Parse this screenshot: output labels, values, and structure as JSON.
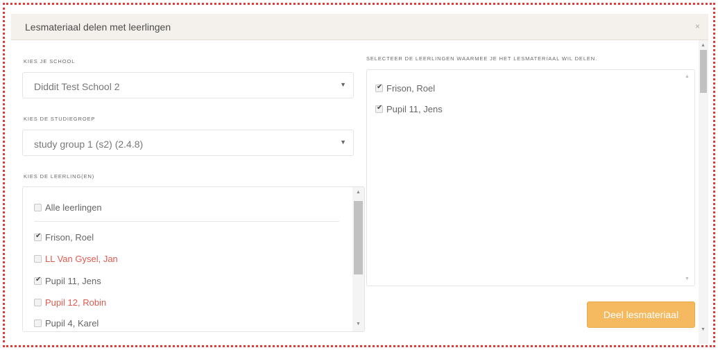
{
  "modal": {
    "title": "Lesmateriaal delen met leerlingen",
    "close_label": "×"
  },
  "school": {
    "label": "KIES JE SCHOOL",
    "selected": "Diddit Test School 2"
  },
  "studygroup": {
    "label": "KIES DE STUDIEGROEP",
    "selected": "study group 1 (s2) (2.4.8)"
  },
  "students": {
    "label": "KIES DE LEERLING(EN)",
    "all_label": "Alle leerlingen",
    "items": [
      {
        "name": "Frison, Roel",
        "checked": true,
        "red": false
      },
      {
        "name": "LL Van Gysel, Jan",
        "checked": false,
        "red": true
      },
      {
        "name": "Pupil 11, Jens",
        "checked": true,
        "red": false
      },
      {
        "name": "Pupil 12, Robin",
        "checked": false,
        "red": true
      },
      {
        "name": "Pupil 4, Karel",
        "checked": false,
        "red": false
      }
    ]
  },
  "selected": {
    "label": "SELECTEER DE LEERLINGEN WAARMEE JE HET LESMATERIAAL WIL DELEN.",
    "items": [
      {
        "name": "Frison, Roel",
        "checked": true
      },
      {
        "name": "Pupil 11, Jens",
        "checked": true
      }
    ]
  },
  "actions": {
    "share_label": "Deel lesmateriaal"
  },
  "colors": {
    "frame": "#e53935",
    "header_bg": "#f4f1ec",
    "button_bg": "#f5b95f",
    "inactive_student": "#e05a4e"
  },
  "icons": {
    "dropdown": "triangle-down",
    "checkbox": "check-mark"
  }
}
